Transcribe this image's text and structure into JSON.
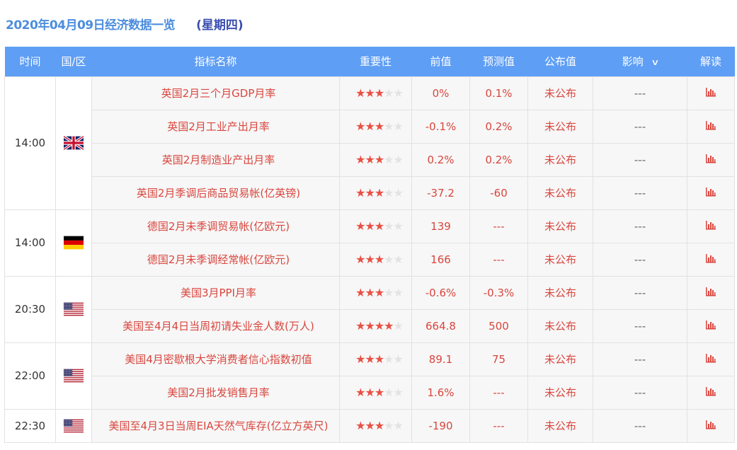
{
  "header": {
    "title": "2020年04月09日经济数据一览",
    "weekday": "(星期四)"
  },
  "columns": {
    "time": "时间",
    "country": "国/区",
    "indicator": "指标名称",
    "importance": "重要性",
    "previous": "前值",
    "forecast": "预测值",
    "actual": "公布值",
    "impact": "影响",
    "interpret": "解读"
  },
  "colors": {
    "header_bg": "#5e9ef5",
    "accent_red": "#d9463e",
    "star_on": "#e85145",
    "star_off": "#e3e3e3"
  },
  "rows": [
    {
      "time": "14:00",
      "flag": "uk-flag",
      "name": "英国2月三个月GDP月率",
      "stars": 3,
      "previous": "0%",
      "forecast": "0.1%",
      "actual": "未公布",
      "impact": "---",
      "icon": "bar-chart-icon"
    },
    {
      "name": "英国2月工业产出月率",
      "stars": 3,
      "previous": "-0.1%",
      "forecast": "0.2%",
      "actual": "未公布",
      "impact": "---",
      "icon": "bar-chart-icon"
    },
    {
      "name": "英国2月制造业产出月率",
      "stars": 3,
      "previous": "0.2%",
      "forecast": "0.2%",
      "actual": "未公布",
      "impact": "---",
      "icon": "bar-chart-icon"
    },
    {
      "name": "英国2月季调后商品贸易帐(亿英镑)",
      "stars": 3,
      "previous": "-37.2",
      "forecast": "-60",
      "actual": "未公布",
      "impact": "---",
      "icon": "bar-chart-icon"
    },
    {
      "time": "14:00",
      "flag": "germany-flag",
      "name": "德国2月未季调贸易帐(亿欧元)",
      "stars": 3,
      "previous": "139",
      "forecast": "---",
      "actual": "未公布",
      "impact": "---",
      "icon": "bar-chart-icon"
    },
    {
      "name": "德国2月未季调经常帐(亿欧元)",
      "stars": 3,
      "previous": "166",
      "forecast": "---",
      "actual": "未公布",
      "impact": "---",
      "icon": "bar-chart-icon"
    },
    {
      "time": "20:30",
      "flag": "us-flag",
      "name": "美国3月PPI月率",
      "stars": 3,
      "previous": "-0.6%",
      "forecast": "-0.3%",
      "actual": "未公布",
      "impact": "---",
      "icon": "bar-chart-icon"
    },
    {
      "name": "美国至4月4日当周初请失业金人数(万人)",
      "stars": 4,
      "previous": "664.8",
      "forecast": "500",
      "actual": "未公布",
      "impact": "---",
      "icon": "bar-chart-icon"
    },
    {
      "time": "22:00",
      "flag": "us-flag",
      "name": "美国4月密歇根大学消费者信心指数初值",
      "stars": 3,
      "previous": "89.1",
      "forecast": "75",
      "actual": "未公布",
      "impact": "---",
      "icon": "bar-chart-icon"
    },
    {
      "name": "美国2月批发销售月率",
      "stars": 3,
      "previous": "1.6%",
      "forecast": "---",
      "actual": "未公布",
      "impact": "---",
      "icon": "bar-chart-icon"
    },
    {
      "time": "22:30",
      "flag": "us-flag",
      "name": "美国至4月3日当周EIA天然气库存(亿立方英尺)",
      "stars": 3,
      "previous": "-190",
      "forecast": "---",
      "actual": "未公布",
      "impact": "---",
      "icon": "bar-chart-icon"
    }
  ]
}
